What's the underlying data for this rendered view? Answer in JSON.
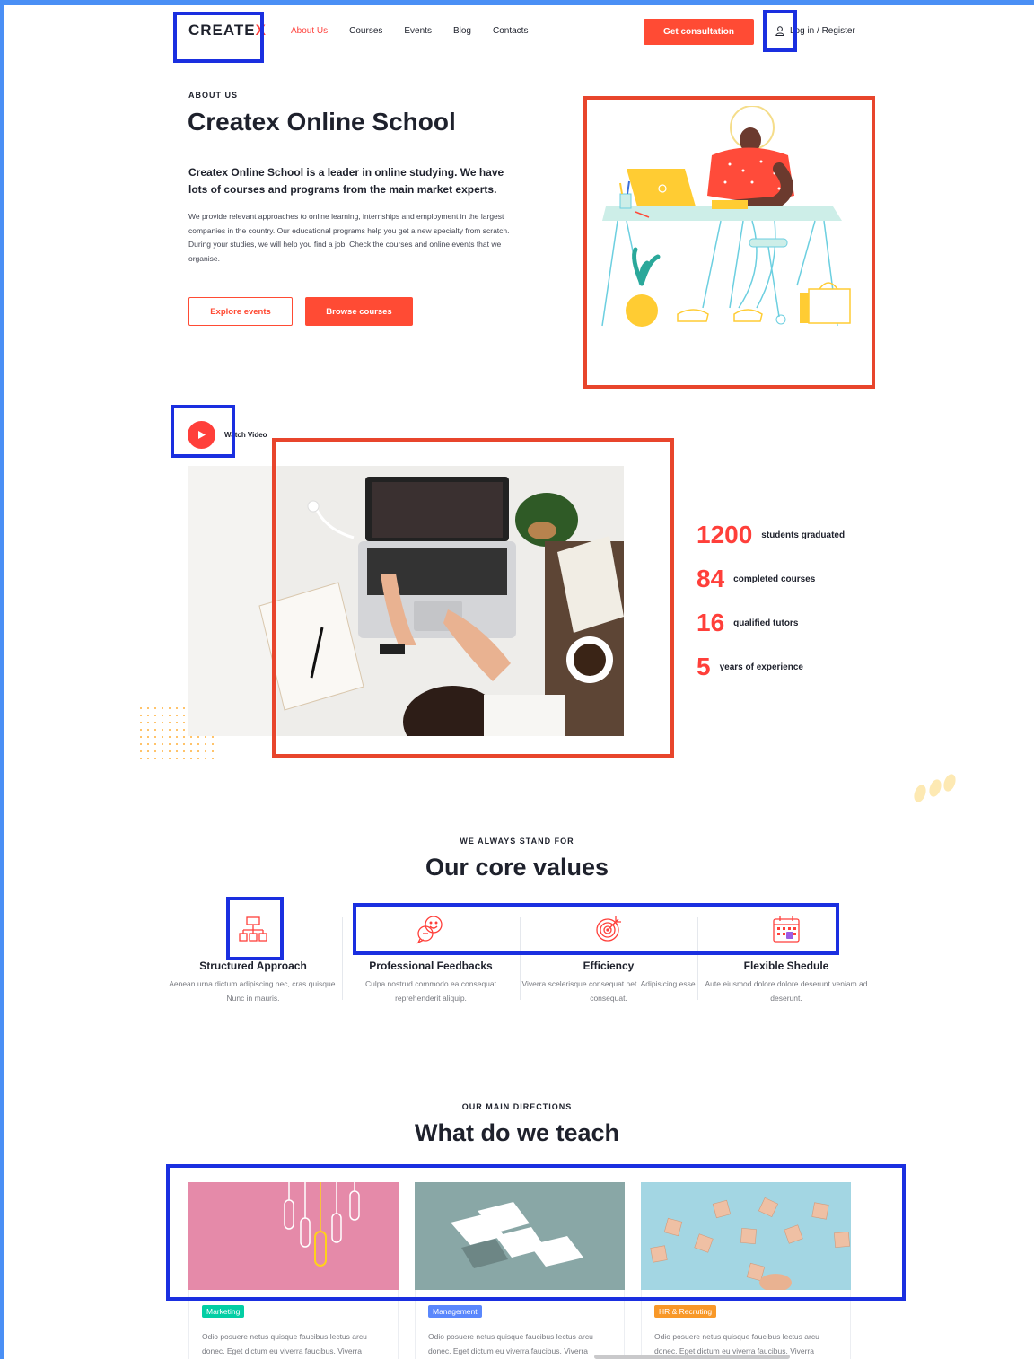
{
  "header": {
    "logo_text": "CREATE",
    "logo_accent": "X",
    "nav": [
      "About Us",
      "Courses",
      "Events",
      "Blog",
      "Contacts"
    ],
    "active_nav": "About Us",
    "consult_label": "Get consultation",
    "login_label": "Log in / Register"
  },
  "hero": {
    "eyebrow": "ABOUT US",
    "title": "Createx Online School",
    "lead": "Createx Online School is a leader in online studying. We have lots of courses and programs from the main market experts.",
    "text": "We provide relevant approaches to online learning, internships and employment in the largest companies in the country. Our educational programs help you get a new specialty from scratch. During your studies, we will help you find a job. Check the courses and online events that we organise.",
    "explore_label": "Explore events",
    "browse_label": "Browse courses"
  },
  "video": {
    "label": "Watch Video"
  },
  "stats": [
    {
      "value": "1200",
      "label": "students graduated"
    },
    {
      "value": "84",
      "label": "completed courses"
    },
    {
      "value": "16",
      "label": "qualified tutors"
    },
    {
      "value": "5",
      "label": "years of experience"
    }
  ],
  "values": {
    "eyebrow": "WE ALWAYS STAND FOR",
    "title": "Our core values",
    "items": [
      {
        "title": "Structured Approach",
        "text": "Aenean urna dictum adipiscing nec, cras quisque. Nunc in mauris.",
        "icon": "structure-icon"
      },
      {
        "title": "Professional Feedbacks",
        "text": "Culpa nostrud commodo ea consequat reprehenderit aliquip.",
        "icon": "feedback-chat-icon"
      },
      {
        "title": "Efficiency",
        "text": "Viverra scelerisque consequat net. Adipisicing esse consequat.",
        "icon": "target-icon"
      },
      {
        "title": "Flexible Shedule",
        "text": "Aute eiusmod dolore dolore deserunt veniam ad deserunt.",
        "icon": "calendar-icon"
      }
    ]
  },
  "teach": {
    "eyebrow": "OUR MAIN DIRECTIONS",
    "title": "What do we teach",
    "cards": [
      {
        "tag": "Marketing",
        "tag_color": "#03cea4",
        "text": "Odio posuere netus quisque faucibus lectus arcu donec. Eget dictum eu viverra faucibus. Viverra"
      },
      {
        "tag": "Management",
        "tag_color": "#5a87fc",
        "text": "Odio posuere netus quisque faucibus lectus arcu donec. Eget dictum eu viverra faucibus. Viverra"
      },
      {
        "tag": "HR & Recruting",
        "tag_color": "#f89828",
        "text": "Odio posuere netus quisque faucibus lectus arcu donec. Eget dictum eu viverra faucibus. Viverra"
      }
    ]
  },
  "colors": {
    "accent": "#ff3f3a",
    "button": "#ff4b34",
    "dark": "#1e212c",
    "highlight_blue": "#1a2fe0",
    "highlight_red": "#e8452c"
  }
}
